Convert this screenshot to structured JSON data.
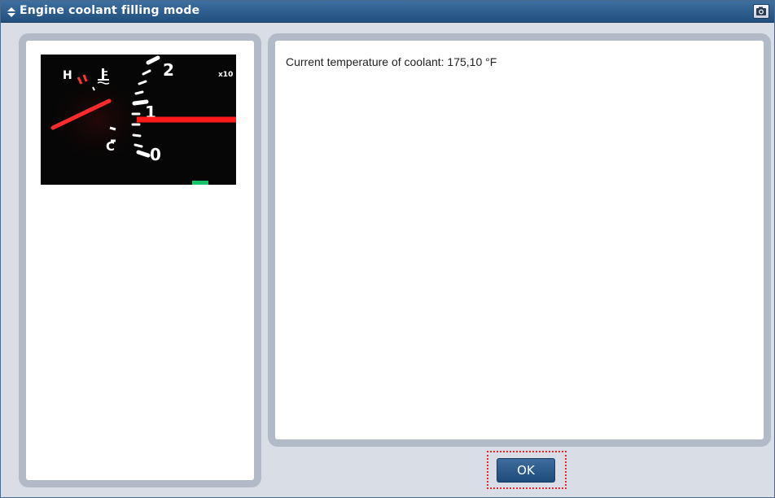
{
  "window": {
    "title": "Engine coolant filling mode",
    "title_icon": "up-down-arrows-icon",
    "camera_icon": "camera-icon"
  },
  "gauge": {
    "label_h": "H",
    "label_c": "C",
    "tach_2": "2",
    "tach_1": "1",
    "tach_0": "0",
    "tach_multiplier": "x10"
  },
  "message": {
    "text": "Current temperature of coolant: 175,10 °F"
  },
  "buttons": {
    "ok_label": "OK"
  },
  "colors": {
    "titlebar": "#21507f",
    "panel_border": "#b2bac8",
    "focus_ring": "#e8262a",
    "needle": "#ff2a2a"
  }
}
